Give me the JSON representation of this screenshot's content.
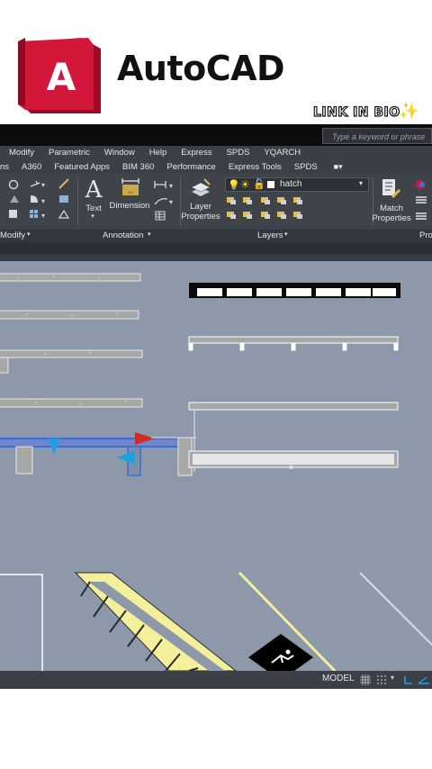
{
  "app": {
    "brand": "AutoCAD",
    "logo_letter": "A",
    "brand_color": "#c8102e"
  },
  "overlay": {
    "link_text": "LINK IN BIO",
    "sparkle": "✨"
  },
  "search": {
    "placeholder": "Type a keyword or phrase"
  },
  "menu": [
    "Modify",
    "Parametric",
    "Window",
    "Help",
    "Express",
    "SPDS",
    "YQARCH"
  ],
  "tabs": [
    "ns",
    "A360",
    "Featured Apps",
    "BIM 360",
    "Performance",
    "Express Tools",
    "SPDS"
  ],
  "ribbon": {
    "text_label": "Text",
    "dimension_label": "Dimension",
    "layer_properties_label": "Layer Properties",
    "layer_current": "hatch",
    "match_properties_label": "Match Properties",
    "panels": {
      "modify": "Modify",
      "annotation": "Annotation",
      "layers": "Layers",
      "properties": "Pro"
    }
  },
  "status": {
    "model_label": "MODEL"
  },
  "colors": {
    "canvas": "#8d99ab",
    "ribbon": "#3f444b",
    "selection_blue": "#3b6fd8",
    "grip_cyan": "#1aa3e0",
    "hatch_yellow": "#f3ef9a",
    "wheelchair_sign": "#000000"
  }
}
